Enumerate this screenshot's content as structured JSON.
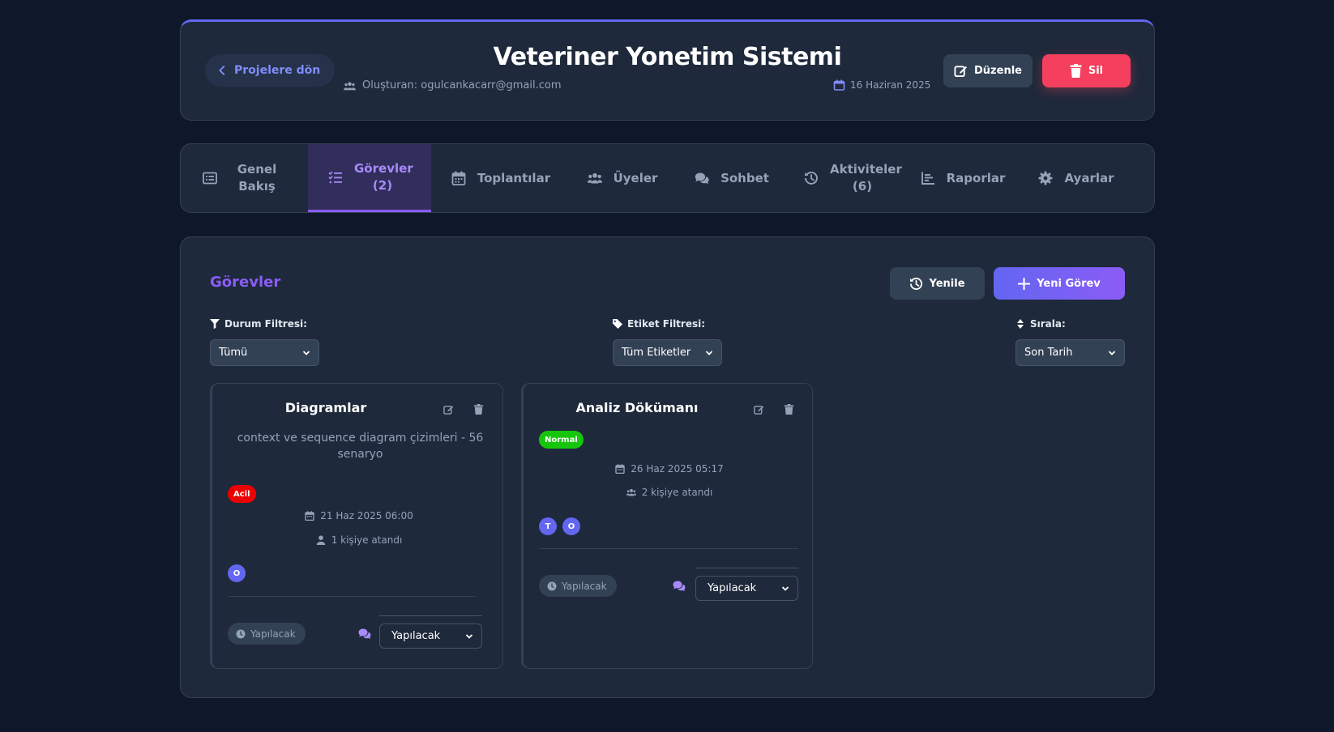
{
  "header": {
    "back_label": "Projelere dön",
    "title": "Veteriner Yonetim Sistemi",
    "creator": "Oluşturan: ogulcankacarr@gmail.com",
    "date": "16 Haziran 2025",
    "edit_label": "Düzenle",
    "delete_label": "Sil"
  },
  "tabs": [
    {
      "label": "Genel Bakış",
      "icon": "list-alt-icon",
      "active": false
    },
    {
      "label": "Görevler (2)",
      "icon": "tasks-icon",
      "active": true
    },
    {
      "label": "Toplantılar",
      "icon": "calendar-icon",
      "active": false
    },
    {
      "label": "Üyeler",
      "icon": "users-icon",
      "active": false
    },
    {
      "label": "Sohbet",
      "icon": "comments-icon",
      "active": false
    },
    {
      "label": "Aktiviteler (6)",
      "icon": "history-icon",
      "active": false
    },
    {
      "label": "Raporlar",
      "icon": "chart-icon",
      "active": false
    },
    {
      "label": "Ayarlar",
      "icon": "gear-icon",
      "active": false
    }
  ],
  "tasks_section": {
    "title": "Görevler",
    "refresh_label": "Yenile",
    "new_label": "Yeni Görev",
    "filters": {
      "status_label": "Durum Filtresi:",
      "status_value": "Tümü",
      "tag_label": "Etiket Filtresi:",
      "tag_value": "Tüm Etiketler",
      "sort_label": "Sırala:",
      "sort_value": "Son Tarih"
    }
  },
  "tasks": [
    {
      "title": "Diagramlar",
      "description": "context ve sequence diagram çizimleri - 56 senaryo",
      "priority": "Acil",
      "priority_color": "#ef0000",
      "due": "21 Haz 2025 06:00",
      "assigned": "1 kişiye atandı",
      "avatars": [
        "O"
      ],
      "status": "Yapılacak",
      "status_select": "Yapılacak"
    },
    {
      "title": "Analiz Dökümanı",
      "description": "",
      "priority": "Normal",
      "priority_color": "#16c60c",
      "due": "26 Haz 2025 05:17",
      "assigned": "2 kişiye atandı",
      "avatars": [
        "T",
        "O"
      ],
      "status": "Yapılacak",
      "status_select": "Yapılacak"
    }
  ],
  "colors": {
    "background": "#0f172a",
    "panel": "#1e293b",
    "accent": "#8b5cf6",
    "danger": "#f43f5e"
  }
}
